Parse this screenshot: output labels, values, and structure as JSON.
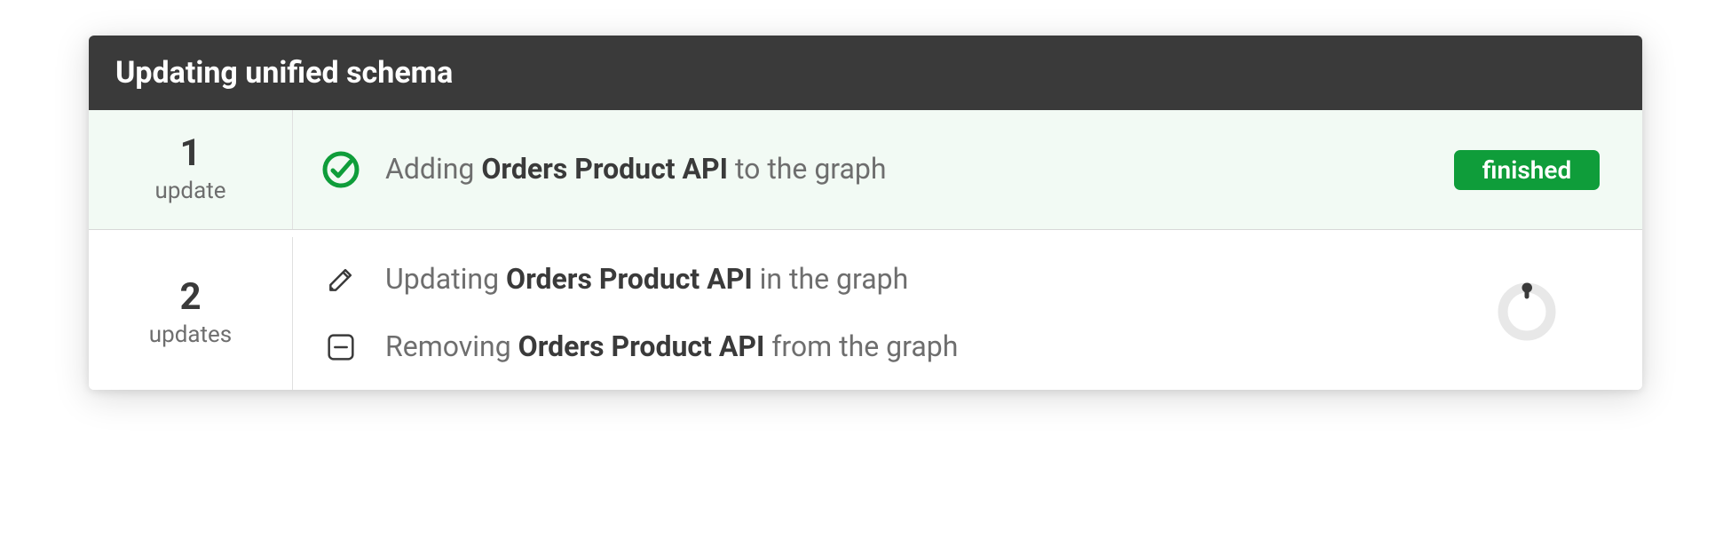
{
  "header": {
    "title": "Updating unified schema"
  },
  "updates": [
    {
      "count": "1",
      "count_label": "update",
      "status": "finished",
      "status_label": "finished",
      "tasks": [
        {
          "icon": "check-circle",
          "prefix": "Adding ",
          "subject": "Orders Product API",
          "suffix": " to the graph"
        }
      ]
    },
    {
      "count": "2",
      "count_label": "updates",
      "status": "in-progress",
      "tasks": [
        {
          "icon": "pencil",
          "prefix": "Updating ",
          "subject": "Orders Product API",
          "suffix": " in the graph"
        },
        {
          "icon": "minus-square",
          "prefix": "Removing ",
          "subject": "Orders Product API",
          "suffix": " from the graph"
        }
      ]
    }
  ]
}
